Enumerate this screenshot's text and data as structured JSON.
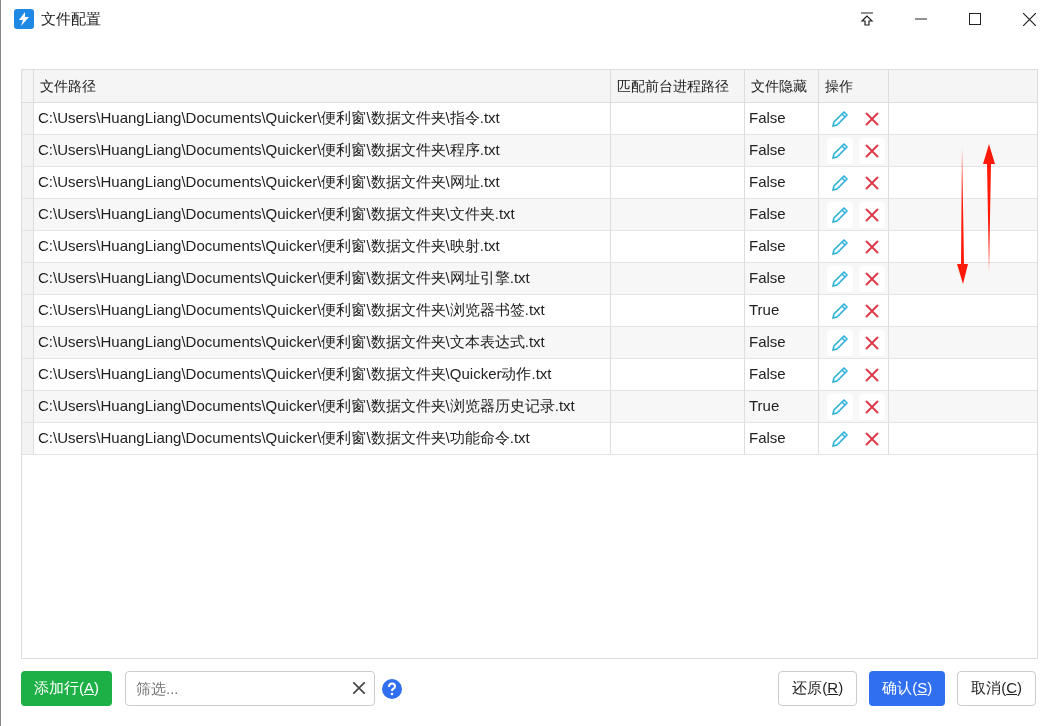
{
  "window": {
    "title": "文件配置"
  },
  "table": {
    "columns": [
      "文件路径",
      "匹配前台进程路径",
      "文件隐藏",
      "操作"
    ],
    "rows": [
      {
        "path": "C:\\Users\\HuangLiang\\Documents\\Quicker\\便利窗\\数据文件夹\\指令.txt",
        "hidden": "False"
      },
      {
        "path": "C:\\Users\\HuangLiang\\Documents\\Quicker\\便利窗\\数据文件夹\\程序.txt",
        "hidden": "False"
      },
      {
        "path": "C:\\Users\\HuangLiang\\Documents\\Quicker\\便利窗\\数据文件夹\\网址.txt",
        "hidden": "False"
      },
      {
        "path": "C:\\Users\\HuangLiang\\Documents\\Quicker\\便利窗\\数据文件夹\\文件夹.txt",
        "hidden": "False"
      },
      {
        "path": "C:\\Users\\HuangLiang\\Documents\\Quicker\\便利窗\\数据文件夹\\映射.txt",
        "hidden": "False"
      },
      {
        "path": "C:\\Users\\HuangLiang\\Documents\\Quicker\\便利窗\\数据文件夹\\网址引擎.txt",
        "hidden": "False"
      },
      {
        "path": "C:\\Users\\HuangLiang\\Documents\\Quicker\\便利窗\\数据文件夹\\浏览器书签.txt",
        "hidden": "True"
      },
      {
        "path": "C:\\Users\\HuangLiang\\Documents\\Quicker\\便利窗\\数据文件夹\\文本表达式.txt",
        "hidden": "False"
      },
      {
        "path": "C:\\Users\\HuangLiang\\Documents\\Quicker\\便利窗\\数据文件夹\\Quicker动作.txt",
        "hidden": "False"
      },
      {
        "path": "C:\\Users\\HuangLiang\\Documents\\Quicker\\便利窗\\数据文件夹\\浏览器历史记录.txt",
        "hidden": "True"
      },
      {
        "path": "C:\\Users\\HuangLiang\\Documents\\Quicker\\便利窗\\数据文件夹\\功能命令.txt",
        "hidden": "False"
      }
    ]
  },
  "footer": {
    "add_button": {
      "prefix": "添加行(",
      "hotkey": "A",
      "suffix": ")"
    },
    "filter": {
      "placeholder": "筛选..."
    },
    "buttons": [
      {
        "kind": "plain",
        "prefix": "还原(",
        "hotkey": "R",
        "suffix": ")"
      },
      {
        "kind": "primary",
        "prefix": "确认(",
        "hotkey": "S",
        "suffix": ")"
      },
      {
        "kind": "plain",
        "prefix": "取消(",
        "hotkey": "C",
        "suffix": ")"
      }
    ]
  }
}
